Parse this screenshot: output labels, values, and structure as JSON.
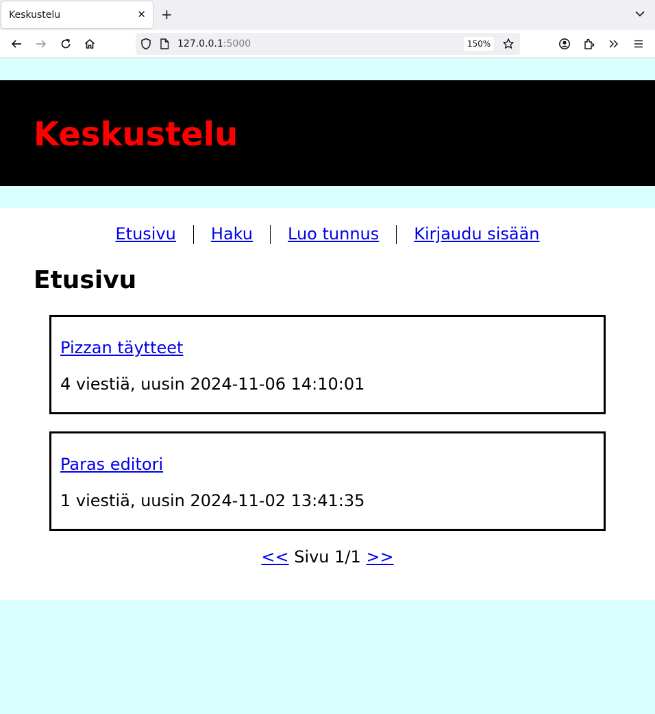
{
  "browser": {
    "tab_title": "Keskustelu",
    "url_host": "127.0.0.1",
    "url_port": ":5000",
    "zoom": "150%"
  },
  "site": {
    "title": "Keskustelu"
  },
  "nav": {
    "items": [
      {
        "label": "Etusivu"
      },
      {
        "label": "Haku"
      },
      {
        "label": "Luo tunnus"
      },
      {
        "label": "Kirjaudu sisään"
      }
    ]
  },
  "page": {
    "heading": "Etusivu"
  },
  "threads": [
    {
      "title": "Pizzan täytteet",
      "meta": "4 viestiä, uusin 2024-11-06 14:10:01"
    },
    {
      "title": "Paras editori",
      "meta": "1 viestiä, uusin 2024-11-02 13:41:35"
    }
  ],
  "pager": {
    "prev": "<<",
    "label": "Sivu 1/1",
    "next": ">>"
  }
}
